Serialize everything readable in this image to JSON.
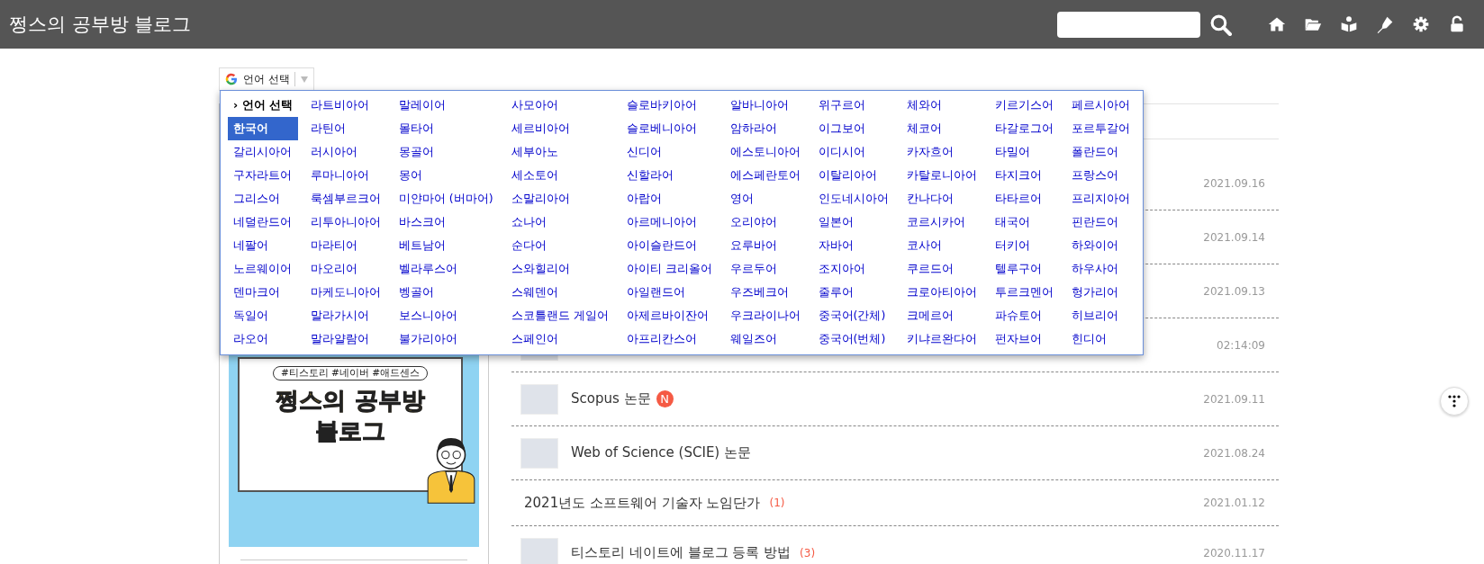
{
  "header": {
    "title": "쩡스의 공부방 블로그"
  },
  "translate_widget": {
    "label": "언어 선택"
  },
  "language_menu": {
    "current": "› 언어 선택",
    "languages": [
      {
        "label": "한국어",
        "selected": true
      },
      {
        "label": "갈리시아어",
        "selected": false
      },
      {
        "label": "구자라트어",
        "selected": false
      },
      {
        "label": "그리스어",
        "selected": false
      },
      {
        "label": "네덜란드어",
        "selected": false
      },
      {
        "label": "네팔어",
        "selected": false
      },
      {
        "label": "노르웨이어",
        "selected": false
      },
      {
        "label": "덴마크어",
        "selected": false
      },
      {
        "label": "독일어",
        "selected": false
      },
      {
        "label": "라오어",
        "selected": false
      },
      {
        "label": "라트비아어",
        "selected": false
      },
      {
        "label": "라틴어",
        "selected": false
      },
      {
        "label": "러시아어",
        "selected": false
      },
      {
        "label": "루마니아어",
        "selected": false
      },
      {
        "label": "룩셈부르크어",
        "selected": false
      },
      {
        "label": "리투아니아어",
        "selected": false
      },
      {
        "label": "마라티어",
        "selected": false
      },
      {
        "label": "마오리어",
        "selected": false
      },
      {
        "label": "마케도니아어",
        "selected": false
      },
      {
        "label": "말라가시어",
        "selected": false
      },
      {
        "label": "말라얄람어",
        "selected": false
      },
      {
        "label": "말레이어",
        "selected": false
      },
      {
        "label": "몰타어",
        "selected": false
      },
      {
        "label": "몽골어",
        "selected": false
      },
      {
        "label": "몽어",
        "selected": false
      },
      {
        "label": "미얀마어 (버마어)",
        "selected": false
      },
      {
        "label": "바스크어",
        "selected": false
      },
      {
        "label": "베트남어",
        "selected": false
      },
      {
        "label": "벨라루스어",
        "selected": false
      },
      {
        "label": "벵골어",
        "selected": false
      },
      {
        "label": "보스니아어",
        "selected": false
      },
      {
        "label": "불가리아어",
        "selected": false
      },
      {
        "label": "사모아어",
        "selected": false
      },
      {
        "label": "세르비아어",
        "selected": false
      },
      {
        "label": "세부아노",
        "selected": false
      },
      {
        "label": "세소토어",
        "selected": false
      },
      {
        "label": "소말리아어",
        "selected": false
      },
      {
        "label": "쇼나어",
        "selected": false
      },
      {
        "label": "순다어",
        "selected": false
      },
      {
        "label": "스와힐리어",
        "selected": false
      },
      {
        "label": "스웨덴어",
        "selected": false
      },
      {
        "label": "스코틀랜드 게일어",
        "selected": false
      },
      {
        "label": "스페인어",
        "selected": false
      },
      {
        "label": "슬로바키아어",
        "selected": false
      },
      {
        "label": "슬로베니아어",
        "selected": false
      },
      {
        "label": "신디어",
        "selected": false
      },
      {
        "label": "신할라어",
        "selected": false
      },
      {
        "label": "아랍어",
        "selected": false
      },
      {
        "label": "아르메니아어",
        "selected": false
      },
      {
        "label": "아이슬란드어",
        "selected": false
      },
      {
        "label": "아이티 크리올어",
        "selected": false
      },
      {
        "label": "아일랜드어",
        "selected": false
      },
      {
        "label": "아제르바이잔어",
        "selected": false
      },
      {
        "label": "아프리칸스어",
        "selected": false
      },
      {
        "label": "알바니아어",
        "selected": false
      },
      {
        "label": "암하라어",
        "selected": false
      },
      {
        "label": "에스토니아어",
        "selected": false
      },
      {
        "label": "에스페란토어",
        "selected": false
      },
      {
        "label": "영어",
        "selected": false
      },
      {
        "label": "오리야어",
        "selected": false
      },
      {
        "label": "요루바어",
        "selected": false
      },
      {
        "label": "우르두어",
        "selected": false
      },
      {
        "label": "우즈베크어",
        "selected": false
      },
      {
        "label": "우크라이나어",
        "selected": false
      },
      {
        "label": "웨일즈어",
        "selected": false
      },
      {
        "label": "위구르어",
        "selected": false
      },
      {
        "label": "이그보어",
        "selected": false
      },
      {
        "label": "이디시어",
        "selected": false
      },
      {
        "label": "이탈리아어",
        "selected": false
      },
      {
        "label": "인도네시아어",
        "selected": false
      },
      {
        "label": "일본어",
        "selected": false
      },
      {
        "label": "자바어",
        "selected": false
      },
      {
        "label": "조지아어",
        "selected": false
      },
      {
        "label": "줄루어",
        "selected": false
      },
      {
        "label": "중국어(간체)",
        "selected": false
      },
      {
        "label": "중국어(번체)",
        "selected": false
      },
      {
        "label": "체와어",
        "selected": false
      },
      {
        "label": "체코어",
        "selected": false
      },
      {
        "label": "카자흐어",
        "selected": false
      },
      {
        "label": "카탈로니아어",
        "selected": false
      },
      {
        "label": "칸나다어",
        "selected": false
      },
      {
        "label": "코르시카어",
        "selected": false
      },
      {
        "label": "코사어",
        "selected": false
      },
      {
        "label": "쿠르드어",
        "selected": false
      },
      {
        "label": "크로아티아어",
        "selected": false
      },
      {
        "label": "크메르어",
        "selected": false
      },
      {
        "label": "키냐르완다어",
        "selected": false
      },
      {
        "label": "키르기스어",
        "selected": false
      },
      {
        "label": "타갈로그어",
        "selected": false
      },
      {
        "label": "타밀어",
        "selected": false
      },
      {
        "label": "타지크어",
        "selected": false
      },
      {
        "label": "타타르어",
        "selected": false
      },
      {
        "label": "태국어",
        "selected": false
      },
      {
        "label": "터키어",
        "selected": false
      },
      {
        "label": "텔루구어",
        "selected": false
      },
      {
        "label": "투르크멘어",
        "selected": false
      },
      {
        "label": "파슈토어",
        "selected": false
      },
      {
        "label": "펀자브어",
        "selected": false
      },
      {
        "label": "페르시아어",
        "selected": false
      },
      {
        "label": "포르투갈어",
        "selected": false
      },
      {
        "label": "폴란드어",
        "selected": false
      },
      {
        "label": "프랑스어",
        "selected": false
      },
      {
        "label": "프리지아어",
        "selected": false
      },
      {
        "label": "핀란드어",
        "selected": false
      },
      {
        "label": "하와이어",
        "selected": false
      },
      {
        "label": "하우사어",
        "selected": false
      },
      {
        "label": "헝가리어",
        "selected": false
      },
      {
        "label": "히브리어",
        "selected": false
      },
      {
        "label": "힌디어",
        "selected": false
      }
    ]
  },
  "sidebar": {
    "banner": {
      "tags": "#티스토리 #네이버 #애드센스",
      "title_line_1": "쩡스의 공부방",
      "title_line_2": "블로그"
    }
  },
  "posts": [
    {
      "date": "2021.09.16"
    },
    {
      "date": "2021.09.14"
    },
    {
      "date": "2021.09.13"
    },
    {
      "thumbnail": true,
      "date": "02:14:09"
    },
    {
      "thumbnail": true,
      "title": "Scopus 논문",
      "new_badge": "N",
      "date": "2021.09.11"
    },
    {
      "thumbnail": true,
      "title": "Web of Science (SCIE) 논문",
      "date": "2021.08.24"
    },
    {
      "thumbnail": false,
      "title": "2021년도 소프트웨어 기술자 노임단가",
      "count": "(1)",
      "date": "2021.01.12"
    },
    {
      "thumbnail": true,
      "title": "티스토리 네이트에 블로그 등록 방법",
      "count": "(3)",
      "date": "2020.11.17"
    }
  ]
}
